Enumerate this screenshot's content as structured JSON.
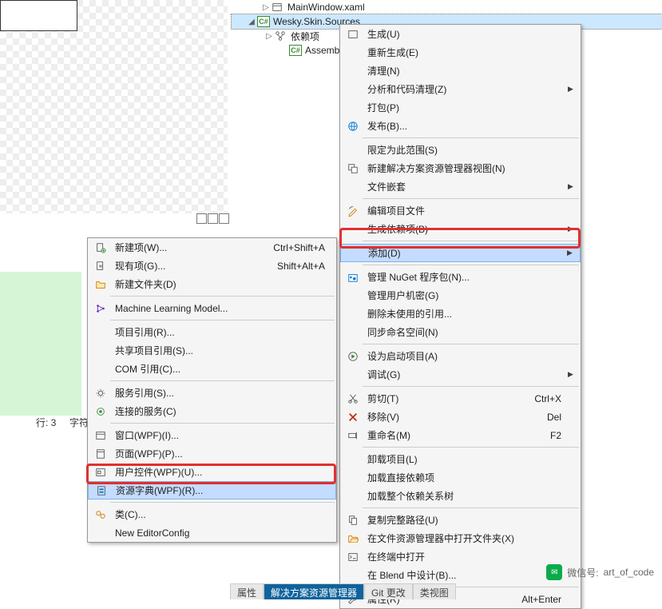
{
  "tree": {
    "items": [
      {
        "indent": 36,
        "expander": "▷",
        "icon": "xaml",
        "label": "MainWindow.xaml"
      },
      {
        "indent": 18,
        "expander": "◢",
        "icon": "csproj",
        "label": "Wesky.Skin.Sources",
        "selected": true
      },
      {
        "indent": 40,
        "expander": "▷",
        "icon": "deps",
        "label": "依赖项"
      },
      {
        "indent": 58,
        "expander": "",
        "icon": "cs",
        "label": "AssemblyIn"
      }
    ]
  },
  "status": {
    "line": "行: 3",
    "char": "字符"
  },
  "submenu": {
    "groups": [
      [
        {
          "icon": "new-item",
          "label": "新建项(W)...",
          "shortcut": "Ctrl+Shift+A"
        },
        {
          "icon": "existing",
          "label": "现有项(G)...",
          "shortcut": "Shift+Alt+A"
        },
        {
          "icon": "folder",
          "label": "新建文件夹(D)",
          "shortcut": ""
        }
      ],
      [
        {
          "icon": "ml",
          "label": "Machine Learning Model...",
          "shortcut": ""
        }
      ],
      [
        {
          "icon": "",
          "label": "项目引用(R)...",
          "shortcut": ""
        },
        {
          "icon": "",
          "label": "共享项目引用(S)...",
          "shortcut": ""
        },
        {
          "icon": "",
          "label": "COM 引用(C)...",
          "shortcut": ""
        }
      ],
      [
        {
          "icon": "service",
          "label": "服务引用(S)...",
          "shortcut": ""
        },
        {
          "icon": "connected",
          "label": "连接的服务(C)",
          "shortcut": ""
        }
      ],
      [
        {
          "icon": "window",
          "label": "窗口(WPF)(I)...",
          "shortcut": ""
        },
        {
          "icon": "page",
          "label": "页面(WPF)(P)...",
          "shortcut": ""
        },
        {
          "icon": "usercontrol",
          "label": "用户控件(WPF)(U)...",
          "shortcut": ""
        },
        {
          "icon": "resdict",
          "label": "资源字典(WPF)(R)...",
          "shortcut": "",
          "highlighted": true
        }
      ],
      [
        {
          "icon": "class",
          "label": "类(C)...",
          "shortcut": ""
        },
        {
          "icon": "",
          "label": "New EditorConfig",
          "shortcut": ""
        }
      ]
    ]
  },
  "mainmenu": {
    "groups": [
      [
        {
          "icon": "build",
          "label": "生成(U)",
          "shortcut": "",
          "arrow": false
        },
        {
          "icon": "",
          "label": "重新生成(E)",
          "shortcut": "",
          "arrow": false
        },
        {
          "icon": "",
          "label": "清理(N)",
          "shortcut": "",
          "arrow": false
        },
        {
          "icon": "",
          "label": "分析和代码清理(Z)",
          "shortcut": "",
          "arrow": true
        },
        {
          "icon": "",
          "label": "打包(P)",
          "shortcut": "",
          "arrow": false
        },
        {
          "icon": "publish",
          "label": "发布(B)...",
          "shortcut": "",
          "arrow": false
        }
      ],
      [
        {
          "icon": "",
          "label": "限定为此范围(S)",
          "shortcut": "",
          "arrow": false
        },
        {
          "icon": "newview",
          "label": "新建解决方案资源管理器视图(N)",
          "shortcut": "",
          "arrow": false
        },
        {
          "icon": "",
          "label": "文件嵌套",
          "shortcut": "",
          "arrow": true
        }
      ],
      [
        {
          "icon": "editproj",
          "label": "编辑项目文件",
          "shortcut": "",
          "arrow": false
        },
        {
          "icon": "",
          "label": "生成依赖项(B)",
          "shortcut": "",
          "arrow": true
        }
      ],
      [
        {
          "icon": "",
          "label": "添加(D)",
          "shortcut": "",
          "arrow": true,
          "highlighted": true
        }
      ],
      [
        {
          "icon": "nuget",
          "label": "管理 NuGet 程序包(N)...",
          "shortcut": "",
          "arrow": false
        },
        {
          "icon": "",
          "label": "管理用户机密(G)",
          "shortcut": "",
          "arrow": false
        },
        {
          "icon": "",
          "label": "删除未使用的引用...",
          "shortcut": "",
          "arrow": false
        },
        {
          "icon": "",
          "label": "同步命名空间(N)",
          "shortcut": "",
          "arrow": false
        }
      ],
      [
        {
          "icon": "startup",
          "label": "设为启动项目(A)",
          "shortcut": "",
          "arrow": false
        },
        {
          "icon": "",
          "label": "调试(G)",
          "shortcut": "",
          "arrow": true
        }
      ],
      [
        {
          "icon": "cut",
          "label": "剪切(T)",
          "shortcut": "Ctrl+X",
          "arrow": false
        },
        {
          "icon": "remove",
          "label": "移除(V)",
          "shortcut": "Del",
          "arrow": false
        },
        {
          "icon": "rename",
          "label": "重命名(M)",
          "shortcut": "F2",
          "arrow": false
        }
      ],
      [
        {
          "icon": "",
          "label": "卸载项目(L)",
          "shortcut": "",
          "arrow": false
        },
        {
          "icon": "",
          "label": "加载直接依赖项",
          "shortcut": "",
          "arrow": false
        },
        {
          "icon": "",
          "label": "加载整个依赖关系树",
          "shortcut": "",
          "arrow": false
        }
      ],
      [
        {
          "icon": "copypath",
          "label": "复制完整路径(U)",
          "shortcut": "",
          "arrow": false
        },
        {
          "icon": "openfolder",
          "label": "在文件资源管理器中打开文件夹(X)",
          "shortcut": "",
          "arrow": false
        },
        {
          "icon": "terminal",
          "label": "在终端中打开",
          "shortcut": "",
          "arrow": false
        },
        {
          "icon": "",
          "label": "在 Blend 中设计(B)...",
          "shortcut": "",
          "arrow": false
        }
      ],
      [
        {
          "icon": "props",
          "label": "属性(R)",
          "shortcut": "Alt+Enter",
          "arrow": false
        }
      ]
    ]
  },
  "tabs": {
    "items": [
      {
        "label": "属性",
        "active": false
      },
      {
        "label": "解决方案资源管理器",
        "active": true
      },
      {
        "label": "Git 更改",
        "active": false
      },
      {
        "label": "类视图",
        "active": false
      }
    ]
  },
  "watermark": {
    "prefix": "微信号:",
    "value": "art_of_code"
  },
  "colors": {
    "highlight": "#c4dcff",
    "highlightBorder": "#7eb4ea",
    "redbox": "#e03030"
  }
}
